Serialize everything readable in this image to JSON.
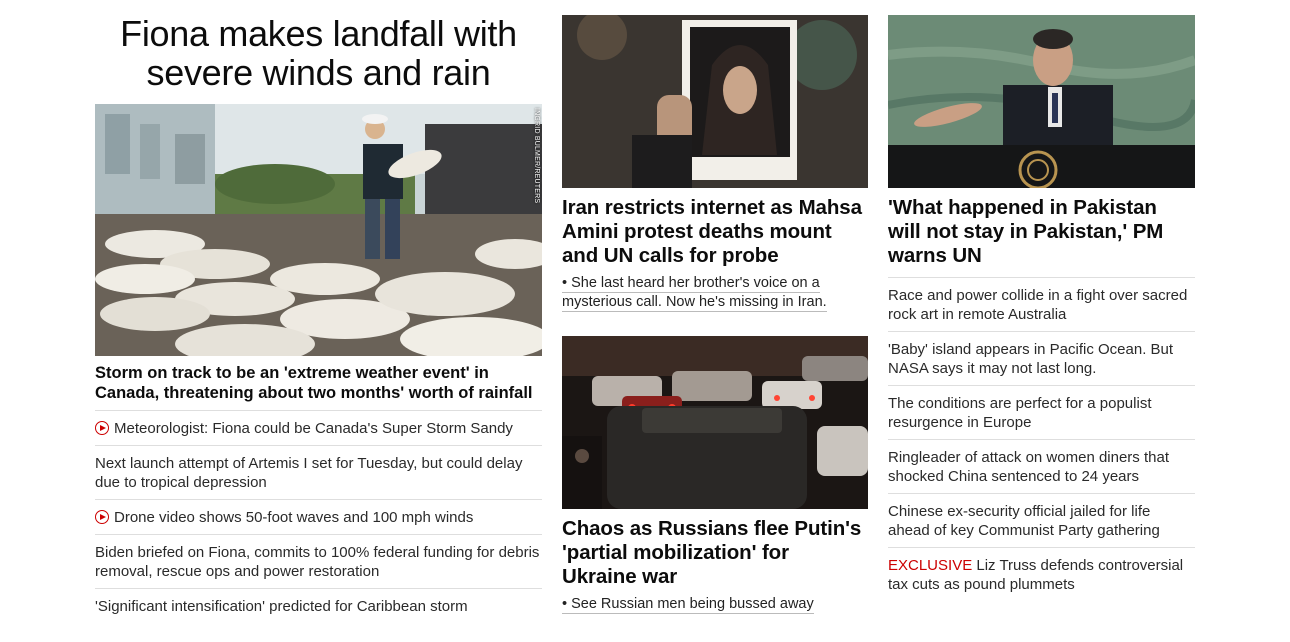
{
  "col1": {
    "lead_title": "Fiona makes landfall with severe winds and rain",
    "image_credit": "INGRID BULMER/REUTERS",
    "sub_headline": "Storm on track to be an 'extreme weather event' in Canada, threatening about two months' worth of rainfall",
    "links": [
      {
        "text": "Meteorologist: Fiona could be Canada's Super Storm Sandy",
        "video": true
      },
      {
        "text": "Next launch attempt of Artemis I set for Tuesday, but could delay due to tropical depression",
        "video": false
      },
      {
        "text": "Drone video shows 50-foot waves and 100 mph winds",
        "video": true
      },
      {
        "text": "Biden briefed on Fiona, commits to 100% federal funding for debris removal, rescue ops and power restoration",
        "video": false
      },
      {
        "text": "'Significant intensification' predicted for Caribbean storm",
        "video": false
      }
    ]
  },
  "col2": {
    "story1": {
      "headline": "Iran restricts internet as Mahsa Amini protest deaths mount and UN calls for probe",
      "bullet": "• She last heard her brother's voice on a mysterious call. Now he's missing in Iran."
    },
    "story2": {
      "headline": "Chaos as Russians flee Putin's 'partial mobilization' for Ukraine war",
      "bullet": "• See Russian men being bussed away"
    }
  },
  "col3": {
    "headline": "'What happened in Pakistan will not stay in Pakistan,' PM warns UN",
    "links": [
      {
        "text": "Race and power collide in a fight over sacred rock art in remote Australia"
      },
      {
        "text": "'Baby' island appears in Pacific Ocean. But NASA says it may not last long."
      },
      {
        "text": "The conditions are perfect for a populist resurgence in Europe"
      },
      {
        "text": "Ringleader of attack on women diners that shocked China sentenced to 24 years"
      },
      {
        "text": "Chinese ex-security official jailed for life ahead of key Communist Party gathering"
      }
    ],
    "exclusive_label": "EXCLUSIVE",
    "exclusive_text": " Liz Truss defends controversial tax cuts as pound plummets"
  },
  "colors": {
    "accent": "#cc0000",
    "text": "#0c0c0c",
    "divider": "#dedede"
  },
  "icons": {
    "video": "play-circle-icon"
  }
}
